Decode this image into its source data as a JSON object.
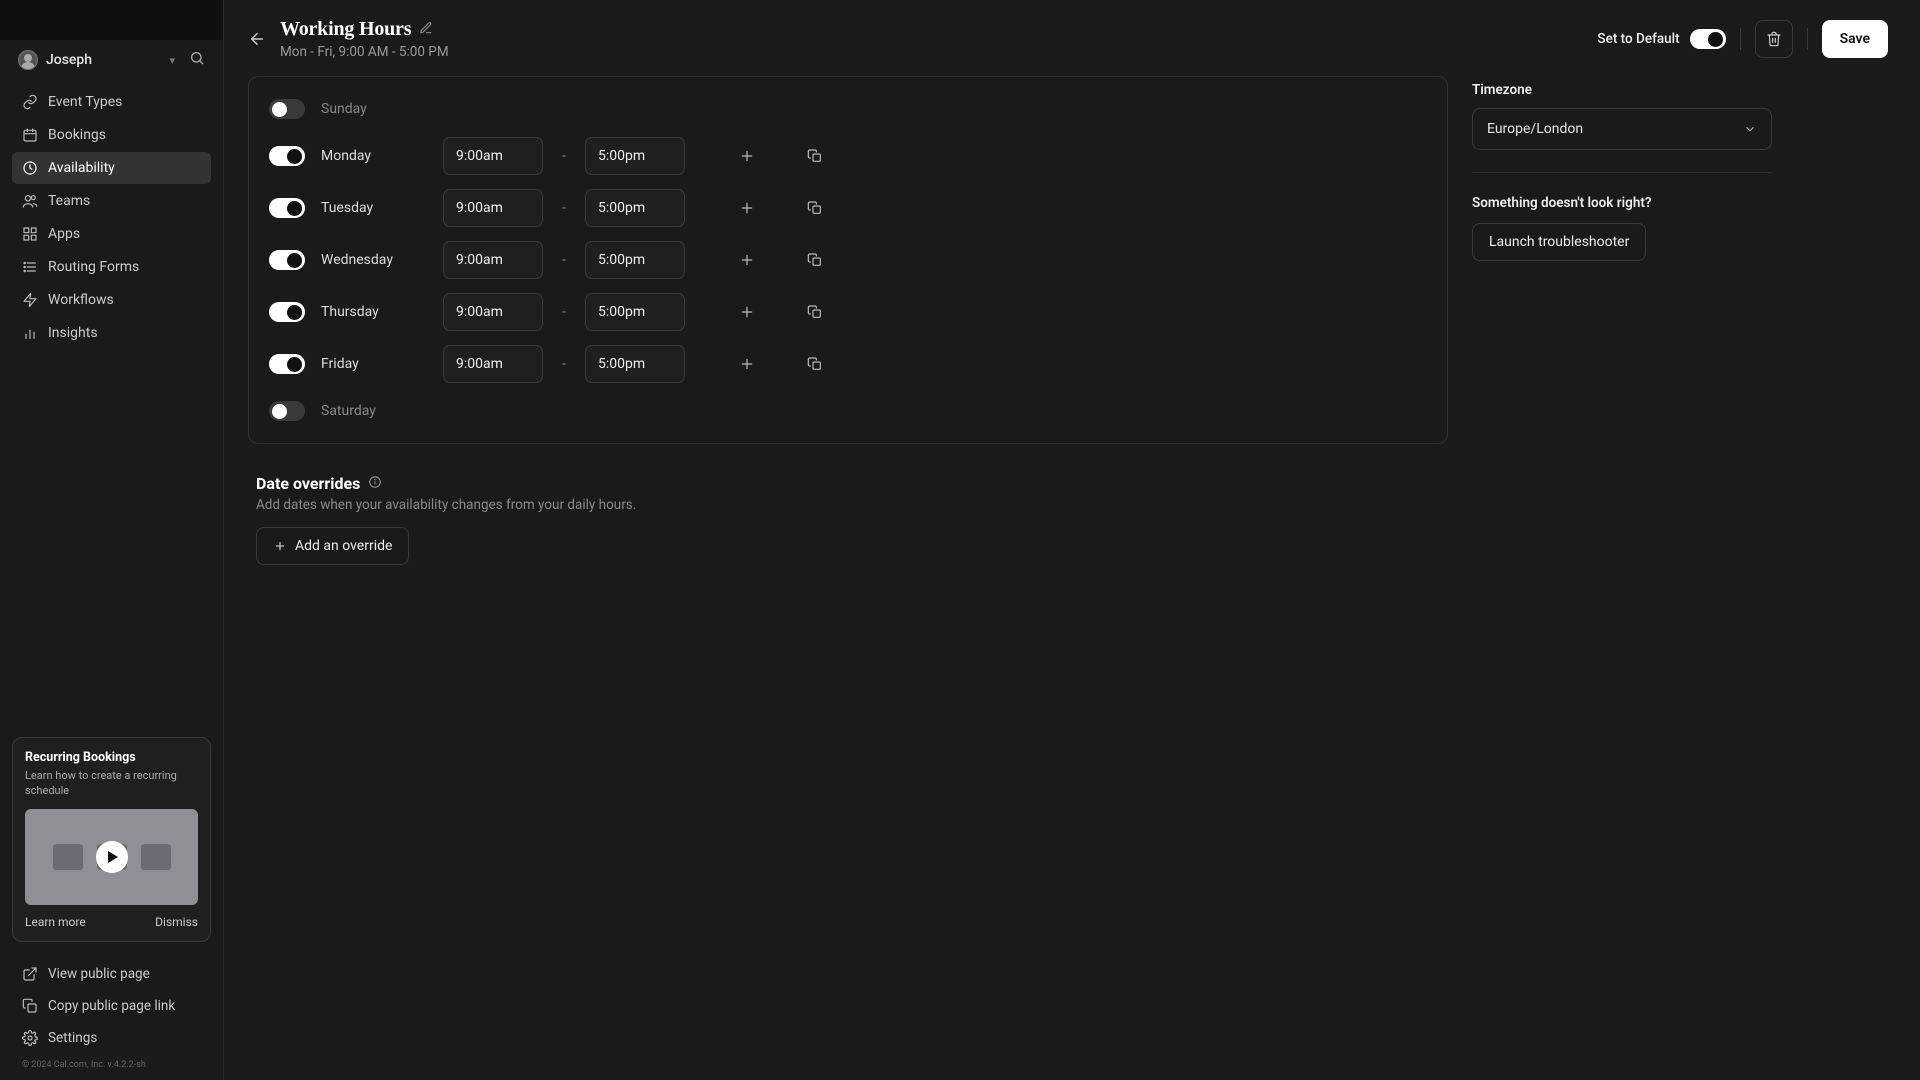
{
  "user": {
    "name": "Joseph"
  },
  "nav": {
    "items": [
      {
        "key": "event-types",
        "label": "Event Types"
      },
      {
        "key": "bookings",
        "label": "Bookings"
      },
      {
        "key": "availability",
        "label": "Availability"
      },
      {
        "key": "teams",
        "label": "Teams"
      },
      {
        "key": "apps",
        "label": "Apps"
      },
      {
        "key": "routing-forms",
        "label": "Routing Forms"
      },
      {
        "key": "workflows",
        "label": "Workflows"
      },
      {
        "key": "insights",
        "label": "Insights"
      }
    ],
    "active": "availability"
  },
  "tip": {
    "title": "Recurring Bookings",
    "desc": "Learn how to create a recurring schedule",
    "learn": "Learn more",
    "dismiss": "Dismiss"
  },
  "bottom_nav": {
    "view_public": "View public page",
    "copy_link": "Copy public page link",
    "settings": "Settings"
  },
  "version": "© 2024 Cal.com, Inc. v.4.2.2-sh",
  "header": {
    "title": "Working Hours",
    "subtitle": "Mon - Fri, 9:00 AM - 5:00 PM",
    "set_default": "Set to Default",
    "set_default_on": true,
    "save": "Save"
  },
  "schedule": {
    "days": [
      {
        "name": "Sunday",
        "enabled": false,
        "start": "",
        "end": ""
      },
      {
        "name": "Monday",
        "enabled": true,
        "start": "9:00am",
        "end": "5:00pm"
      },
      {
        "name": "Tuesday",
        "enabled": true,
        "start": "9:00am",
        "end": "5:00pm"
      },
      {
        "name": "Wednesday",
        "enabled": true,
        "start": "9:00am",
        "end": "5:00pm"
      },
      {
        "name": "Thursday",
        "enabled": true,
        "start": "9:00am",
        "end": "5:00pm"
      },
      {
        "name": "Friday",
        "enabled": true,
        "start": "9:00am",
        "end": "5:00pm"
      },
      {
        "name": "Saturday",
        "enabled": false,
        "start": "",
        "end": ""
      }
    ]
  },
  "overrides": {
    "title": "Date overrides",
    "desc": "Add dates when your availability changes from your daily hours.",
    "add_btn": "Add an override"
  },
  "timezone": {
    "label": "Timezone",
    "value": "Europe/London"
  },
  "troubleshoot": {
    "label": "Something doesn't look right?",
    "btn": "Launch troubleshooter"
  }
}
